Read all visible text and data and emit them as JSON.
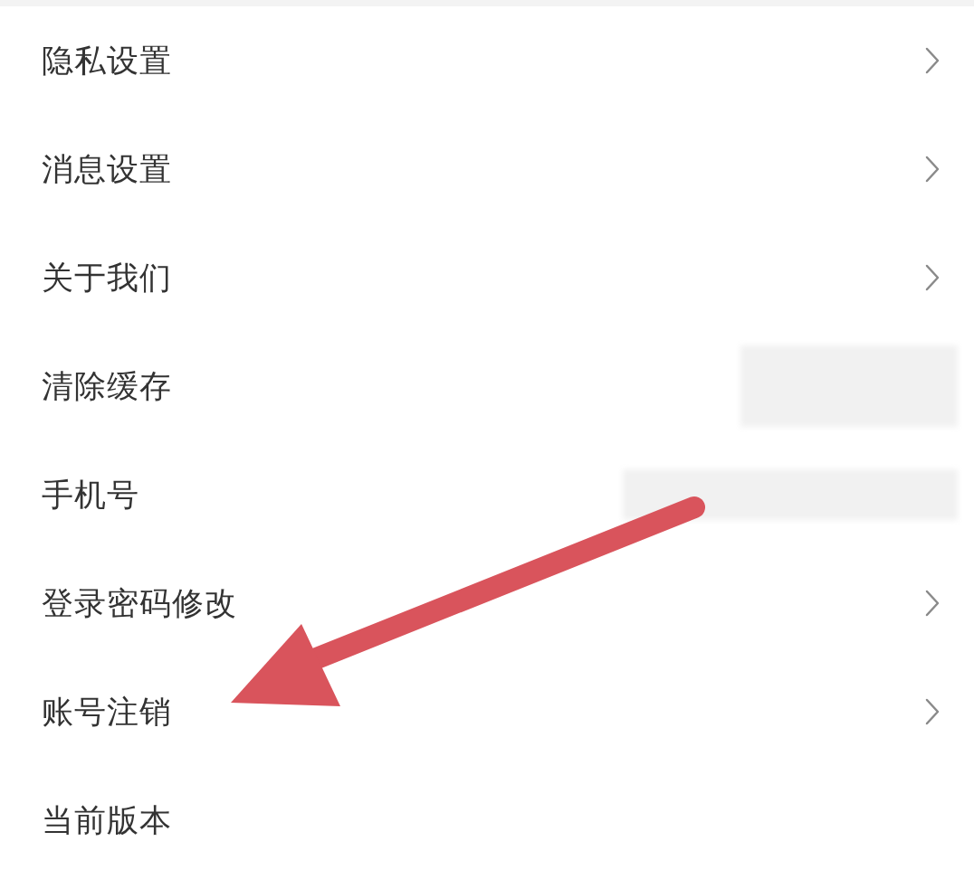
{
  "settings": [
    {
      "label": "隐私设置",
      "chevron": true,
      "redacted": false
    },
    {
      "label": "消息设置",
      "chevron": true,
      "redacted": false
    },
    {
      "label": "关于我们",
      "chevron": true,
      "redacted": false
    },
    {
      "label": "清除缓存",
      "chevron": false,
      "redacted": true
    },
    {
      "label": "手机号",
      "chevron": false,
      "redacted": true
    },
    {
      "label": "登录密码修改",
      "chevron": true,
      "redacted": false
    },
    {
      "label": "账号注销",
      "chevron": true,
      "redacted": false
    },
    {
      "label": "当前版本",
      "chevron": false,
      "redacted": false
    }
  ],
  "annotation": {
    "kind": "arrow"
  }
}
